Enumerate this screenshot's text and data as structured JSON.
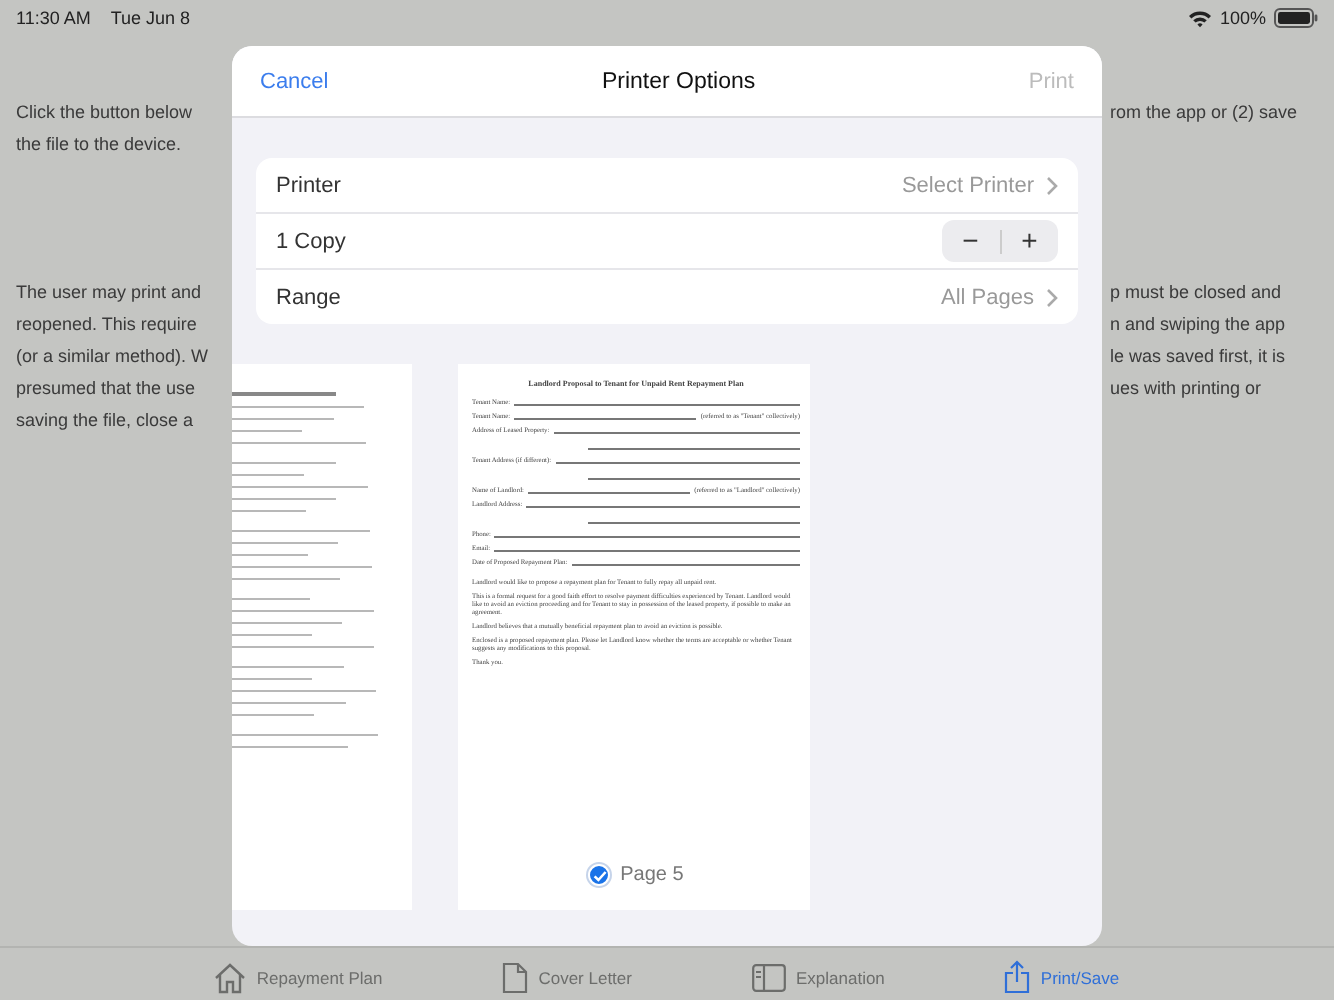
{
  "status_bar": {
    "time": "11:30 AM",
    "date": "Tue Jun 8",
    "battery": "100%"
  },
  "background_text": [
    {
      "left_lines": [
        "Click the button below",
        "the file to the device."
      ],
      "right_lines": [
        "rom the app or (2) save"
      ]
    },
    {
      "left_lines": [
        "The user may print and",
        "reopened. This require",
        "(or a similar method). W",
        "presumed that the use",
        "saving the file, close a"
      ],
      "right_lines": [
        "p must be closed and",
        "n and swiping the app",
        "le was saved first, it is",
        "ues with printing or"
      ]
    }
  ],
  "dialog": {
    "cancel": "Cancel",
    "title": "Printer Options",
    "print": "Print",
    "print_disabled": true,
    "options": [
      {
        "kind": "link",
        "label": "Printer",
        "value": "Select Printer"
      },
      {
        "kind": "stepper",
        "label": "1 Copy",
        "minus": "−",
        "plus": "+"
      },
      {
        "kind": "link",
        "label": "Range",
        "value": "All Pages"
      }
    ],
    "preview": {
      "page_label": "Page 5",
      "selected": true,
      "document": {
        "title": "Landlord Proposal to Tenant for Unpaid Rent Repayment Plan",
        "fields": [
          {
            "kind": "one-line",
            "label": "Tenant Name:"
          },
          {
            "kind": "one-line",
            "label": "Tenant Name:",
            "suffix": "(referred to as \"Tenant\" collectively)"
          },
          {
            "kind": "two-line",
            "label": "Address of Leased Property:"
          },
          {
            "kind": "two-line",
            "label": "Tenant Address (if different):"
          },
          {
            "kind": "one-line",
            "label": "Name of Landlord:",
            "suffix": "(referred to as \"Landlord\" collectively)"
          },
          {
            "kind": "two-line",
            "label": "Landlord Address:"
          },
          {
            "kind": "one-line",
            "label": "Phone:"
          },
          {
            "kind": "one-line",
            "label": "Email:"
          },
          {
            "kind": "one-line",
            "label": "Date of Proposed Repayment Plan:"
          }
        ],
        "paragraphs": [
          "Landlord would like to propose a repayment plan for Tenant to fully repay all unpaid rent.",
          "This is a formal request for a good faith effort to resolve payment difficulties experienced by Tenant. Landlord would like to avoid an eviction proceeding and for Tenant to stay in possession of the leased property, if possible to make an agreement.",
          "Landlord believes that a mutually beneficial repayment plan to avoid an eviction is possible.",
          "Enclosed is a proposed repayment plan. Please let Landlord know whether the terms are acceptable or whether Tenant suggests any modifications to this proposal.",
          "Thank you."
        ]
      }
    }
  },
  "tab_bar": [
    {
      "kind": "house",
      "label": "Repayment Plan",
      "selected": false
    },
    {
      "kind": "document",
      "label": "Cover Letter",
      "selected": false
    },
    {
      "kind": "sidebar",
      "label": "Explanation",
      "selected": false
    },
    {
      "kind": "share",
      "label": "Print/Save",
      "selected": true
    }
  ]
}
